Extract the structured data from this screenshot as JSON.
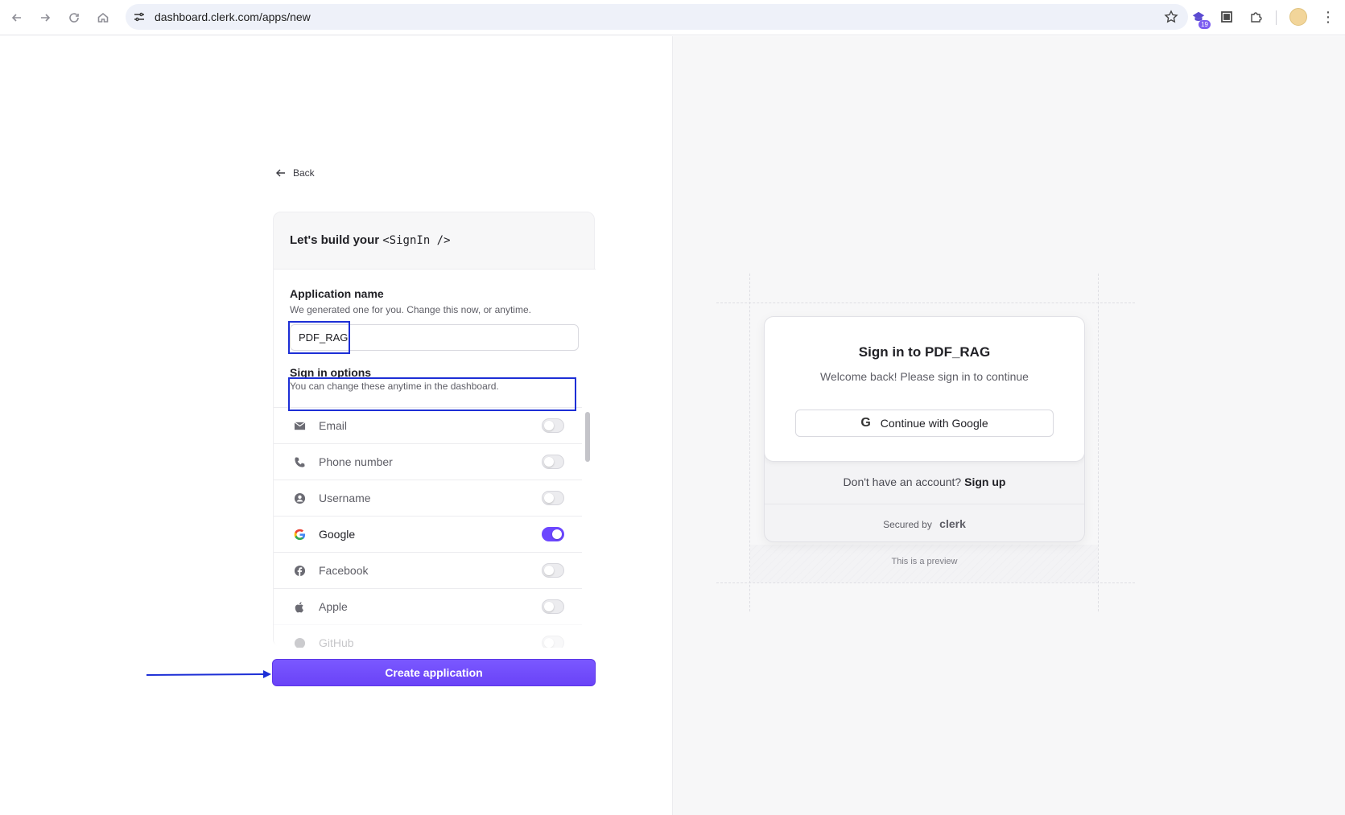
{
  "browser": {
    "url": "dashboard.clerk.com/apps/new",
    "extension_badge": "19"
  },
  "form": {
    "back_label": "Back",
    "header_text": "Let's build your",
    "header_code": "<SignIn />",
    "app_name_label": "Application name",
    "app_name_help": "We generated one for you. Change this now, or anytime.",
    "app_name_value": "PDF_RAG",
    "signin_label": "Sign in options",
    "signin_help": "You can change these anytime in the dashboard.",
    "options": [
      {
        "label": "Email",
        "icon": "mail-icon",
        "enabled": false
      },
      {
        "label": "Phone number",
        "icon": "phone-icon",
        "enabled": false
      },
      {
        "label": "Username",
        "icon": "user-circle-icon",
        "enabled": false
      },
      {
        "label": "Google",
        "icon": "google-icon",
        "enabled": true
      },
      {
        "label": "Facebook",
        "icon": "facebook-icon",
        "enabled": false
      },
      {
        "label": "Apple",
        "icon": "apple-icon",
        "enabled": false
      },
      {
        "label": "GitHub",
        "icon": "github-icon",
        "enabled": false
      }
    ],
    "create_label": "Create application"
  },
  "preview": {
    "title": "Sign in to PDF_RAG",
    "subtitle": "Welcome back! Please sign in to continue",
    "google_button": "Continue with Google",
    "signup_prompt": "Don't have an account?",
    "signup_link": "Sign up",
    "secured_by": "Secured by",
    "brand": "clerk",
    "note": "This is a preview"
  },
  "colors": {
    "accent": "#6c47ff",
    "highlight": "#1d2fd6"
  }
}
